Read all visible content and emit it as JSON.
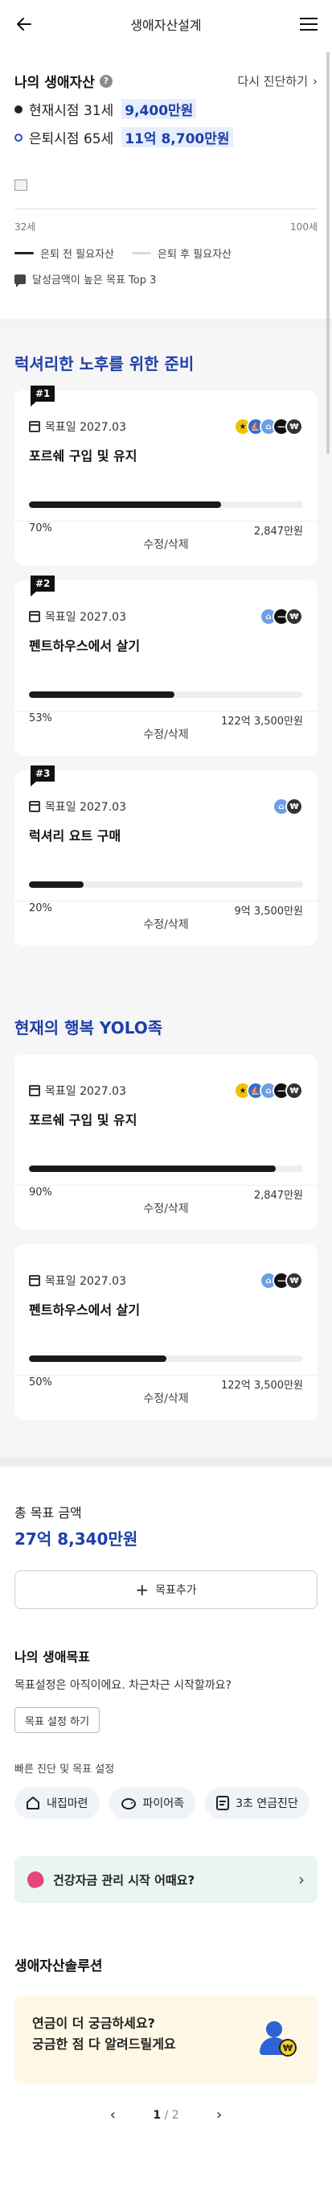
{
  "header": {
    "title": "생애자산설계"
  },
  "my_assets": {
    "title": "나의 생애자산",
    "help_icon": "question-circle-icon",
    "rediagnose_label": "다시 진단하기",
    "current": {
      "label": "현재시점 31세",
      "amount": "9,400만원"
    },
    "retire": {
      "label": "은퇴시점 65세",
      "amount": "11억 8,700만원"
    },
    "age_start": "32세",
    "age_end": "100세",
    "legend": [
      "은퇴 전 필요자산",
      "은퇴 후 필요자산"
    ],
    "top3_label": "달성금액이 높은 목표 Top 3"
  },
  "luxury": {
    "title": "럭셔리한 노후를 위한 준비",
    "cards": [
      {
        "rank": "#1",
        "date": "목표일 2027.03",
        "name": "포르쉐 구입 및 유지",
        "percent": "70%",
        "progress": 0.7,
        "amount": "2,847만원",
        "footer": "수정/삭제",
        "icons": [
          "car-icon",
          "ship-icon",
          "house-icon",
          "coin-icon",
          "bag-icon"
        ]
      },
      {
        "rank": "#2",
        "date": "목표일 2027.03",
        "name": "펜트하우스에서 살기",
        "percent": "53%",
        "progress": 0.53,
        "amount": "122억 3,500만원",
        "footer": "수정/삭제",
        "icons": [
          "house-icon",
          "coin-icon",
          "bag-icon"
        ]
      },
      {
        "rank": "#3",
        "date": "목표일 2027.03",
        "name": "럭셔리 요트 구매",
        "percent": "20%",
        "progress": 0.2,
        "amount": "9억 3,500만원",
        "footer": "수정/삭제",
        "icons": [
          "house-icon",
          "bag-icon"
        ]
      }
    ]
  },
  "yolo": {
    "title": "현재의 행복 YOLO족",
    "cards": [
      {
        "date": "목표일 2027.03",
        "name": "포르쉐 구입 및 유지",
        "percent": "90%",
        "progress": 0.9,
        "amount": "2,847만원",
        "footer": "수정/삭제",
        "icons": [
          "car-icon",
          "ship-icon",
          "house-icon",
          "coin-icon",
          "bag-icon"
        ]
      },
      {
        "date": "목표일 2027.03",
        "name": "펜트하우스에서 살기",
        "percent": "50%",
        "progress": 0.5,
        "amount": "122억 3,500만원",
        "footer": "수정/삭제",
        "icons": [
          "house-icon",
          "coin-icon",
          "bag-icon"
        ]
      }
    ]
  },
  "total": {
    "label": "총 목표 금액",
    "amount": "27억 8,340만원",
    "add_goal": "목표추가"
  },
  "life_goal": {
    "title": "나의 생애목표",
    "desc": "목표설정은 아직이에요. 차근차근 시작할까요?",
    "button": "목표 설정 하기",
    "quick_label": "빠른 진단 및 목표 설정",
    "chips": [
      "내집마련",
      "파이어족",
      "3초 연금진단"
    ]
  },
  "health_banner": {
    "text": "건강자금 관리 시작 어때요?"
  },
  "solution": {
    "title": "생애자산솔루션",
    "line1": "연금이 더 궁금하세요?",
    "line2": "궁금한 점 다 알려드릴게요"
  },
  "pager": {
    "current": "1",
    "total": "/ 2"
  },
  "colors": {
    "accent": "#1d3fa8",
    "bar": "#1a1a1a",
    "banner": "#e9f6ef",
    "solution_bg": "#fff8e6"
  }
}
